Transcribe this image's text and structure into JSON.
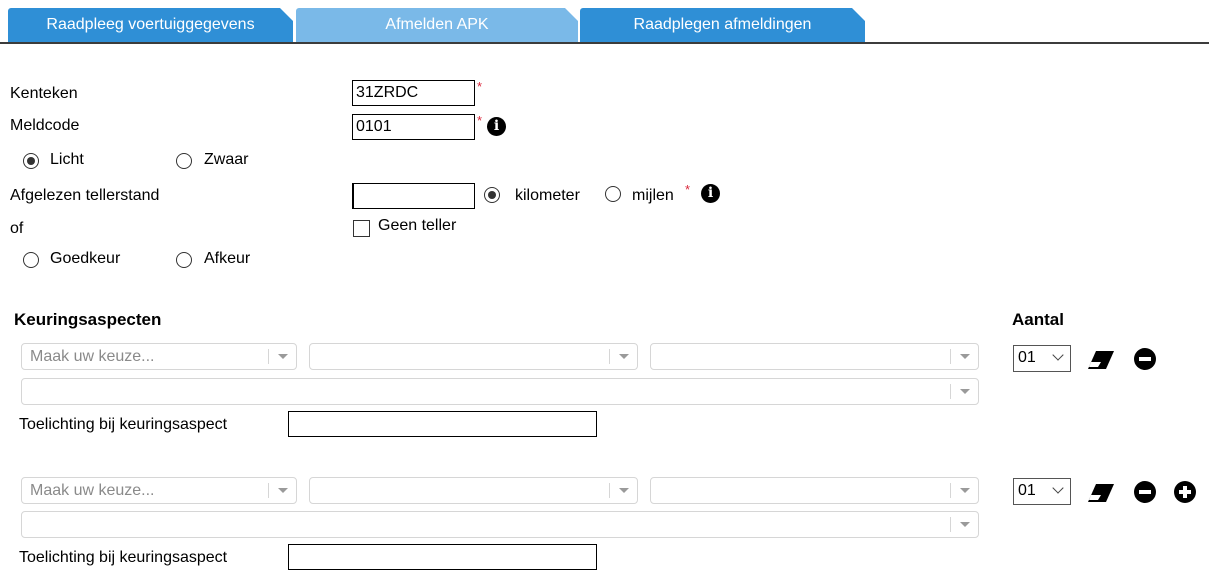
{
  "tabs": [
    {
      "label": "Raadpleeg voertuiggegevens"
    },
    {
      "label": "Afmelden APK"
    },
    {
      "label": "Raadplegen afmeldingen"
    }
  ],
  "form": {
    "kenteken_label": "Kenteken",
    "kenteken_value": "31ZRDC",
    "meldcode_label": "Meldcode",
    "meldcode_value": "0101",
    "required_mark": "*",
    "info_glyph": "i",
    "weight_options": {
      "licht": "Licht",
      "zwaar": "Zwaar",
      "selected": "Licht"
    },
    "tellerstand_label": "Afgelezen tellerstand",
    "tellerstand_value": "",
    "unit_options": {
      "kilometer": "kilometer",
      "mijlen": "mijlen",
      "selected": "kilometer"
    },
    "geen_teller_label": "Geen teller",
    "geen_teller_checked": false,
    "of_label": "of",
    "verdict_options": {
      "goedkeur": "Goedkeur",
      "afkeur": "Afkeur",
      "selected": ""
    }
  },
  "aspects": {
    "heading": "Keuringsaspecten",
    "aantal_heading": "Aantal",
    "rows": [
      {
        "placeholder": "Maak uw keuze...",
        "toelichting_label": "Toelichting bij keuringsaspect",
        "toelichting_value": "",
        "aantal": "01",
        "has_add": false
      },
      {
        "placeholder": "Maak uw keuze...",
        "toelichting_label": "Toelichting bij keuringsaspect",
        "toelichting_value": "",
        "aantal": "01",
        "has_add": true
      }
    ]
  },
  "icons": [
    "info-icon",
    "eraser-icon",
    "remove-icon",
    "add-icon",
    "chevron-down-icon"
  ],
  "colors": {
    "tab_dark": "#2f8fd6",
    "tab_light": "#7ab9e8",
    "required": "#d9263a"
  }
}
